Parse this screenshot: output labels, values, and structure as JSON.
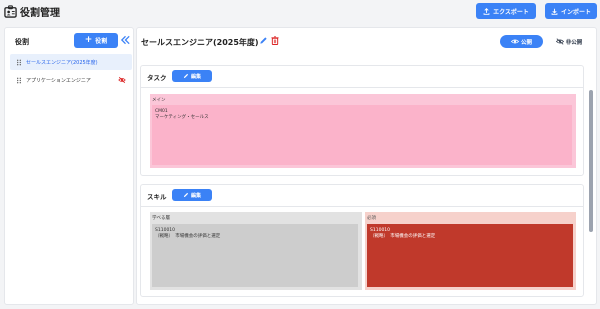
{
  "app": {
    "title": "役割管理",
    "icon": "id-card-icon"
  },
  "header": {
    "export_label": "エクスポート",
    "import_label": "インポート"
  },
  "sidebar": {
    "title": "役割",
    "add_label": "役割",
    "items": [
      {
        "label": "セールスエンジニア(2025年度)",
        "active": true
      },
      {
        "label": "アプリケーションエンジニア",
        "active": false,
        "hidden": true
      }
    ]
  },
  "detail": {
    "title": "セールスエンジニア(2025年度)",
    "public_label": "公開",
    "private_label": "非公開",
    "task": {
      "label": "タスク",
      "edit_label": "編集",
      "groups": [
        {
          "name": "メイン",
          "cards": [
            {
              "code": "CM01",
              "name": "マーケティング・セールス"
            }
          ]
        }
      ]
    },
    "skill": {
      "label": "スキル",
      "edit_label": "編集",
      "groups": [
        {
          "name": "学べる層",
          "cards": [
            {
              "code": "S110010",
              "name": "（戦略）　市場機会の評価と選定"
            }
          ]
        },
        {
          "name": "必須",
          "cards": [
            {
              "code": "S110010",
              "name": "（戦略）　市場機会の評価と選定"
            }
          ]
        }
      ]
    }
  },
  "colors": {
    "accent": "#3b82f6",
    "danger": "#c0392b",
    "task_group": "#fbc6d8",
    "skill_required": "#c0392b"
  }
}
